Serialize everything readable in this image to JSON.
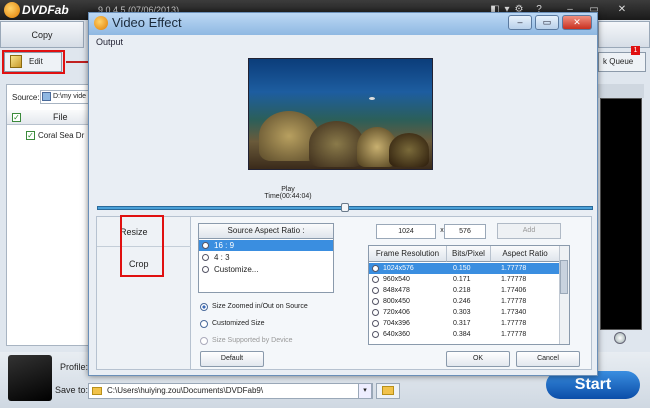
{
  "app": {
    "brand": "DVDFab",
    "version": "9.0.4.5 (07/06/2013)",
    "controls": [
      "◧",
      "▾",
      "⚙",
      "?",
      "–",
      "▭",
      "✕"
    ],
    "tab_copy": "Copy",
    "edit_label": "Edit",
    "task_queue_label": "k Queue",
    "task_queue_badge": "1",
    "source_label": "Source:",
    "source_value": "D:\\my vide",
    "file_header": "File",
    "file_item": "Coral Sea Dr",
    "profile_label": "Profile:",
    "saveto_label": "Save to:",
    "saveto_value": "C:\\Users\\huiying.zou\\Documents\\DVDFab9\\",
    "start_label": "Start"
  },
  "dialog": {
    "title": "Video Effect",
    "output_label": "Output",
    "play_time": "Play Time(00:44:04)",
    "play_progress": 0.5,
    "tabs": [
      "Resize",
      "Crop"
    ],
    "aspect_header": "Source Aspect Ratio :",
    "aspect_options": [
      "16 : 9",
      "4 : 3",
      "Customize..."
    ],
    "aspect_selected": 0,
    "size_options": [
      {
        "label": "Size Zoomed in/Out on Source",
        "selected": true,
        "disabled": false
      },
      {
        "label": "Customized Size",
        "selected": false,
        "disabled": false
      },
      {
        "label": "Size Supported by Device",
        "selected": false,
        "disabled": true
      }
    ],
    "width_value": "1024",
    "times_label": "x",
    "height_value": "576",
    "add_label": "Add",
    "res_headers": [
      "Frame Resolution",
      "Bits/Pixel",
      "Aspect Ratio"
    ],
    "res_rows": [
      [
        "1024x576",
        "0.150",
        "1.77778"
      ],
      [
        "960x540",
        "0.171",
        "1.77778"
      ],
      [
        "848x478",
        "0.218",
        "1.77406"
      ],
      [
        "800x450",
        "0.246",
        "1.77778"
      ],
      [
        "720x406",
        "0.303",
        "1.77340"
      ],
      [
        "704x396",
        "0.317",
        "1.77778"
      ],
      [
        "640x360",
        "0.384",
        "1.77778"
      ]
    ],
    "res_selected": 0,
    "default_label": "Default",
    "ok_label": "OK",
    "cancel_label": "Cancel",
    "controls": [
      "–",
      "▭",
      "✕"
    ]
  },
  "colors": {
    "accent": "#3a8ee0",
    "highlight": "#e01010"
  }
}
